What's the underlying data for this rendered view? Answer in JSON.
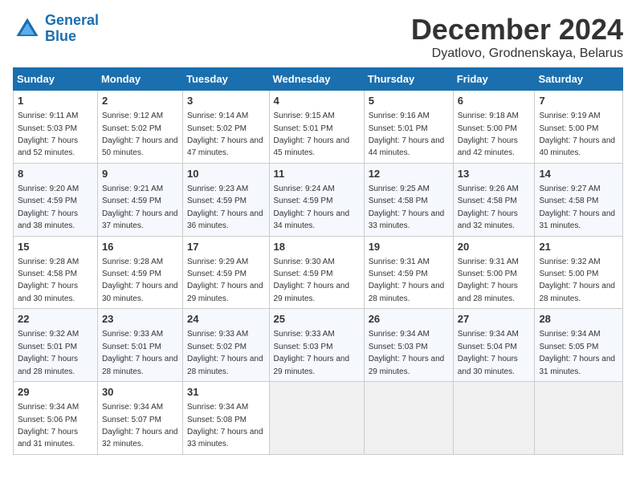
{
  "logo": {
    "line1": "General",
    "line2": "Blue"
  },
  "title": "December 2024",
  "subtitle": "Dyatlovo, Grodnenskaya, Belarus",
  "header_colors": {
    "bg": "#1a6faf",
    "text": "#ffffff"
  },
  "days_of_week": [
    "Sunday",
    "Monday",
    "Tuesday",
    "Wednesday",
    "Thursday",
    "Friday",
    "Saturday"
  ],
  "weeks": [
    [
      {
        "day": "1",
        "sunrise": "9:11 AM",
        "sunset": "5:03 PM",
        "daylight": "7 hours and 52 minutes."
      },
      {
        "day": "2",
        "sunrise": "9:12 AM",
        "sunset": "5:02 PM",
        "daylight": "7 hours and 50 minutes."
      },
      {
        "day": "3",
        "sunrise": "9:14 AM",
        "sunset": "5:02 PM",
        "daylight": "7 hours and 47 minutes."
      },
      {
        "day": "4",
        "sunrise": "9:15 AM",
        "sunset": "5:01 PM",
        "daylight": "7 hours and 45 minutes."
      },
      {
        "day": "5",
        "sunrise": "9:16 AM",
        "sunset": "5:01 PM",
        "daylight": "7 hours and 44 minutes."
      },
      {
        "day": "6",
        "sunrise": "9:18 AM",
        "sunset": "5:00 PM",
        "daylight": "7 hours and 42 minutes."
      },
      {
        "day": "7",
        "sunrise": "9:19 AM",
        "sunset": "5:00 PM",
        "daylight": "7 hours and 40 minutes."
      }
    ],
    [
      {
        "day": "8",
        "sunrise": "9:20 AM",
        "sunset": "4:59 PM",
        "daylight": "7 hours and 38 minutes."
      },
      {
        "day": "9",
        "sunrise": "9:21 AM",
        "sunset": "4:59 PM",
        "daylight": "7 hours and 37 minutes."
      },
      {
        "day": "10",
        "sunrise": "9:23 AM",
        "sunset": "4:59 PM",
        "daylight": "7 hours and 36 minutes."
      },
      {
        "day": "11",
        "sunrise": "9:24 AM",
        "sunset": "4:59 PM",
        "daylight": "7 hours and 34 minutes."
      },
      {
        "day": "12",
        "sunrise": "9:25 AM",
        "sunset": "4:58 PM",
        "daylight": "7 hours and 33 minutes."
      },
      {
        "day": "13",
        "sunrise": "9:26 AM",
        "sunset": "4:58 PM",
        "daylight": "7 hours and 32 minutes."
      },
      {
        "day": "14",
        "sunrise": "9:27 AM",
        "sunset": "4:58 PM",
        "daylight": "7 hours and 31 minutes."
      }
    ],
    [
      {
        "day": "15",
        "sunrise": "9:28 AM",
        "sunset": "4:58 PM",
        "daylight": "7 hours and 30 minutes."
      },
      {
        "day": "16",
        "sunrise": "9:28 AM",
        "sunset": "4:59 PM",
        "daylight": "7 hours and 30 minutes."
      },
      {
        "day": "17",
        "sunrise": "9:29 AM",
        "sunset": "4:59 PM",
        "daylight": "7 hours and 29 minutes."
      },
      {
        "day": "18",
        "sunrise": "9:30 AM",
        "sunset": "4:59 PM",
        "daylight": "7 hours and 29 minutes."
      },
      {
        "day": "19",
        "sunrise": "9:31 AM",
        "sunset": "4:59 PM",
        "daylight": "7 hours and 28 minutes."
      },
      {
        "day": "20",
        "sunrise": "9:31 AM",
        "sunset": "5:00 PM",
        "daylight": "7 hours and 28 minutes."
      },
      {
        "day": "21",
        "sunrise": "9:32 AM",
        "sunset": "5:00 PM",
        "daylight": "7 hours and 28 minutes."
      }
    ],
    [
      {
        "day": "22",
        "sunrise": "9:32 AM",
        "sunset": "5:01 PM",
        "daylight": "7 hours and 28 minutes."
      },
      {
        "day": "23",
        "sunrise": "9:33 AM",
        "sunset": "5:01 PM",
        "daylight": "7 hours and 28 minutes."
      },
      {
        "day": "24",
        "sunrise": "9:33 AM",
        "sunset": "5:02 PM",
        "daylight": "7 hours and 28 minutes."
      },
      {
        "day": "25",
        "sunrise": "9:33 AM",
        "sunset": "5:03 PM",
        "daylight": "7 hours and 29 minutes."
      },
      {
        "day": "26",
        "sunrise": "9:34 AM",
        "sunset": "5:03 PM",
        "daylight": "7 hours and 29 minutes."
      },
      {
        "day": "27",
        "sunrise": "9:34 AM",
        "sunset": "5:04 PM",
        "daylight": "7 hours and 30 minutes."
      },
      {
        "day": "28",
        "sunrise": "9:34 AM",
        "sunset": "5:05 PM",
        "daylight": "7 hours and 31 minutes."
      }
    ],
    [
      {
        "day": "29",
        "sunrise": "9:34 AM",
        "sunset": "5:06 PM",
        "daylight": "7 hours and 31 minutes."
      },
      {
        "day": "30",
        "sunrise": "9:34 AM",
        "sunset": "5:07 PM",
        "daylight": "7 hours and 32 minutes."
      },
      {
        "day": "31",
        "sunrise": "9:34 AM",
        "sunset": "5:08 PM",
        "daylight": "7 hours and 33 minutes."
      },
      null,
      null,
      null,
      null
    ]
  ]
}
